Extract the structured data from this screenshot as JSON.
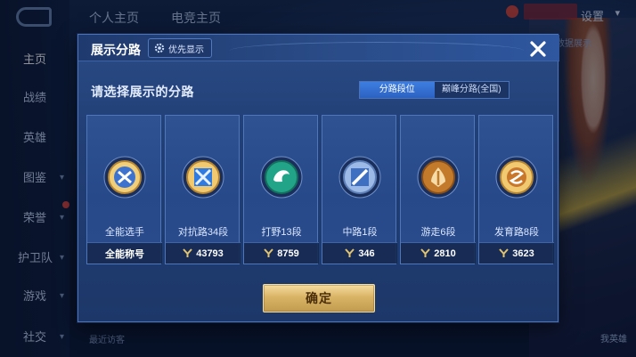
{
  "nav": {
    "items": [
      {
        "label": "主页",
        "chevron": false,
        "active": true
      },
      {
        "label": "战绩",
        "chevron": false
      },
      {
        "label": "英雄",
        "chevron": false
      },
      {
        "label": "图鉴",
        "chevron": true
      },
      {
        "label": "荣誉",
        "chevron": true
      },
      {
        "label": "护卫队",
        "chevron": true
      },
      {
        "label": "游戏",
        "chevron": true
      },
      {
        "label": "社交",
        "chevron": true
      }
    ]
  },
  "topbar": {
    "tab_profile": "个人主页",
    "tab_esports": "电竞主页",
    "settings": "设置"
  },
  "background_text": {
    "peek": "和数据展示",
    "visitor": "最近访客",
    "bottom_right": "我英雄"
  },
  "modal": {
    "title": "展示分路",
    "priority_button": "优先显示",
    "prompt": "请选择展示的分路",
    "toggle": {
      "option_rank": "分路段位",
      "option_peak": "巅峰分路(全国)",
      "selected": "option_rank"
    },
    "cards": [
      {
        "label": "全能选手",
        "stat": "全能称号",
        "show_arrow": false,
        "icon": "all-rounder-emblem-icon",
        "color": "#d9a441"
      },
      {
        "label": "对抗路34段",
        "stat": "43793",
        "show_arrow": true,
        "icon": "clash-lane-emblem-icon",
        "color": "#2f7be0"
      },
      {
        "label": "打野13段",
        "stat": "8759",
        "show_arrow": true,
        "icon": "jungle-emblem-icon",
        "color": "#1fa486"
      },
      {
        "label": "中路1段",
        "stat": "346",
        "show_arrow": true,
        "icon": "mid-lane-emblem-icon",
        "color": "#5d8ad1"
      },
      {
        "label": "游走6段",
        "stat": "2810",
        "show_arrow": true,
        "icon": "roam-emblem-icon",
        "color": "#c47a2b"
      },
      {
        "label": "发育路8段",
        "stat": "3623",
        "show_arrow": true,
        "icon": "farm-lane-emblem-icon",
        "color": "#c9782b"
      }
    ],
    "confirm": "确定"
  }
}
